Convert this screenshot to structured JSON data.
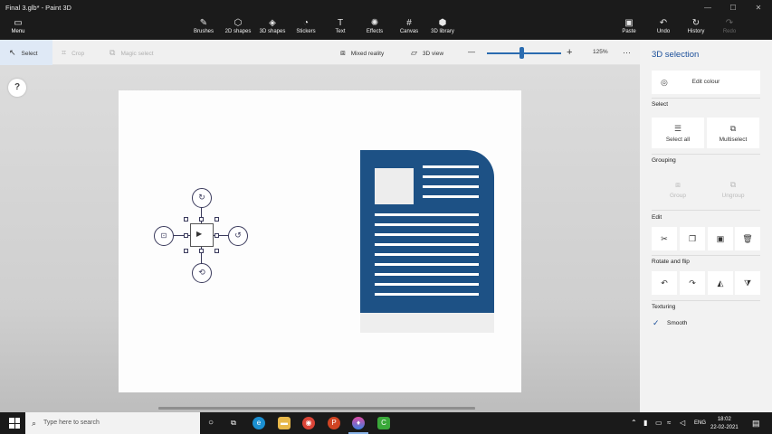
{
  "window": {
    "title": "Final 3.glb* - Paint 3D",
    "min": "—",
    "max": "☐",
    "close": "✕"
  },
  "ribbon": {
    "menu_label": "Menu",
    "tools": [
      {
        "label": "Brushes",
        "icon": "brush-icon"
      },
      {
        "label": "2D shapes",
        "icon": "2d-shapes-icon"
      },
      {
        "label": "3D shapes",
        "icon": "3d-shapes-icon"
      },
      {
        "label": "Stickers",
        "icon": "stickers-icon"
      },
      {
        "label": "Text",
        "icon": "text-icon"
      },
      {
        "label": "Effects",
        "icon": "effects-icon"
      },
      {
        "label": "Canvas",
        "icon": "canvas-icon"
      },
      {
        "label": "3D library",
        "icon": "3d-library-icon"
      }
    ],
    "paste": "Paste",
    "undo": "Undo",
    "history": "History",
    "redo": "Redo"
  },
  "toolbar": {
    "select": "Select",
    "crop": "Crop",
    "magic_select": "Magic select",
    "mixed_reality": "Mixed reality",
    "view_3d": "3D view",
    "zoom_minus": "—",
    "zoom_plus": "+",
    "zoom_level": "125%",
    "zoom_fraction": 0.45,
    "more": "···"
  },
  "help": "?",
  "panel": {
    "title": "3D selection",
    "edit_colour": "Edit colour",
    "select_head": "Select",
    "select_all": "Select all",
    "multiselect": "Multiselect",
    "grouping_head": "Grouping",
    "group": "Group",
    "ungroup": "Ungroup",
    "edit_head": "Edit",
    "rotate_head": "Rotate and flip",
    "texturing_head": "Texturing",
    "smooth": "Smooth"
  },
  "taskbar": {
    "search_placeholder": "Type here to search",
    "language": "ENG",
    "time": "18:02",
    "date": "22-02-2021"
  },
  "colors": {
    "accent": "#1b4f9a",
    "document": "#1d5185"
  }
}
